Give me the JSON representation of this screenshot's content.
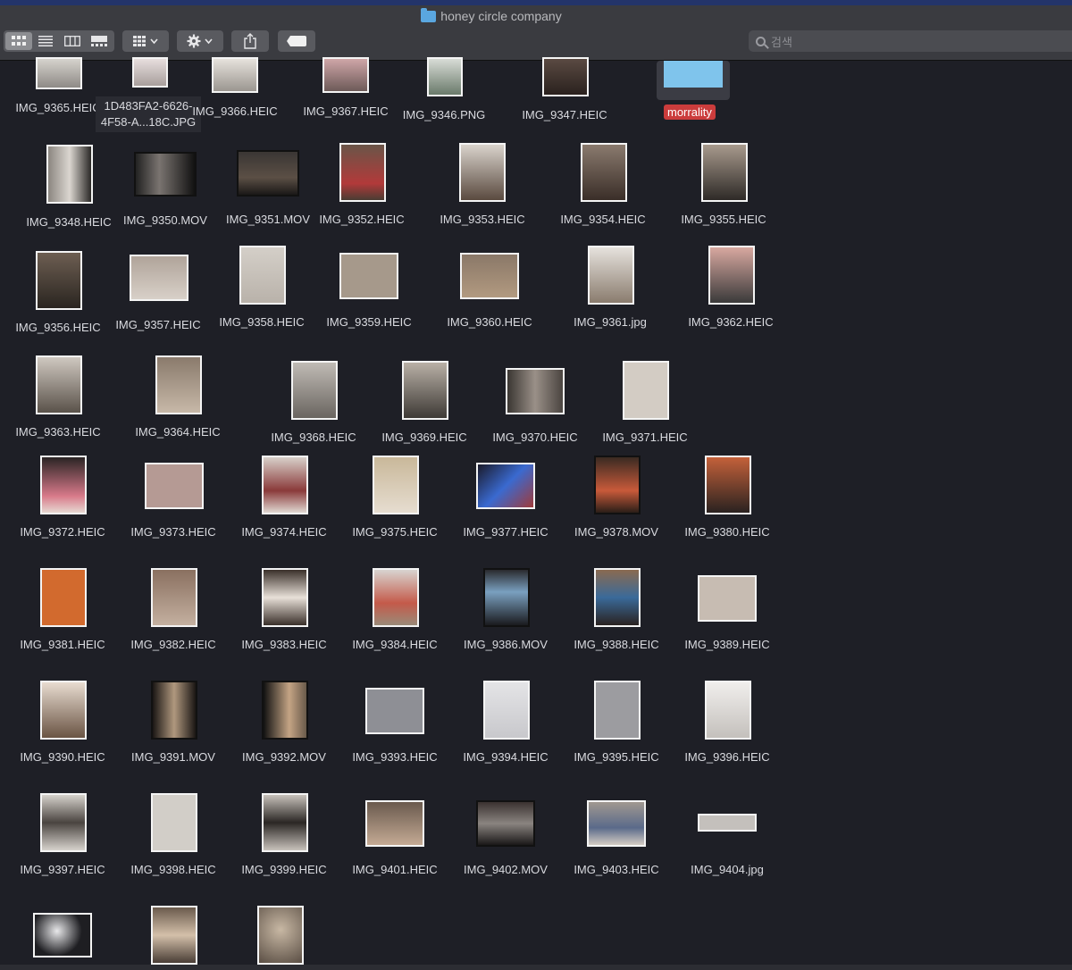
{
  "window": {
    "title": "honey circle company"
  },
  "toolbar": {
    "view_icons": [
      "icon-view-icon",
      "list-view-icon",
      "column-view-icon",
      "gallery-view-icon"
    ],
    "group_label": "group-icon",
    "action_label": "gear-icon",
    "share_label": "share-icon",
    "tag_label": "tag-icon"
  },
  "search": {
    "placeholder": "검색"
  },
  "tag": {
    "label": "morrality",
    "color": "#cb3c3c"
  },
  "files": {
    "row0": [
      "IMG_9365.HEIC",
      "1D483FA2-6626-4F58-A...18C.JPG",
      "IMG_9366.HEIC",
      "IMG_9367.HEIC",
      "IMG_9346.PNG",
      "IMG_9347.HEIC"
    ],
    "row1": [
      "IMG_9348.HEIC",
      "IMG_9350.MOV",
      "IMG_9351.MOV",
      "IMG_9352.HEIC",
      "IMG_9353.HEIC",
      "IMG_9354.HEIC",
      "IMG_9355.HEIC"
    ],
    "row2": [
      "IMG_9356.HEIC",
      "IMG_9357.HEIC",
      "IMG_9358.HEIC",
      "IMG_9359.HEIC",
      "IMG_9360.HEIC",
      "IMG_9361.jpg",
      "IMG_9362.HEIC"
    ],
    "row3": [
      "IMG_9363.HEIC",
      "IMG_9364.HEIC",
      "IMG_9368.HEIC",
      "IMG_9369.HEIC",
      "IMG_9370.HEIC",
      "IMG_9371.HEIC"
    ],
    "row4": [
      "IMG_9372.HEIC",
      "IMG_9373.HEIC",
      "IMG_9374.HEIC",
      "IMG_9375.HEIC",
      "IMG_9377.HEIC",
      "IMG_9378.MOV",
      "IMG_9380.HEIC"
    ],
    "row5": [
      "IMG_9381.HEIC",
      "IMG_9382.HEIC",
      "IMG_9383.HEIC",
      "IMG_9384.HEIC",
      "IMG_9386.MOV",
      "IMG_9388.HEIC",
      "IMG_9389.HEIC"
    ],
    "row6": [
      "IMG_9390.HEIC",
      "IMG_9391.MOV",
      "IMG_9392.MOV",
      "IMG_9393.HEIC",
      "IMG_9394.HEIC",
      "IMG_9395.HEIC",
      "IMG_9396.HEIC"
    ],
    "row7": [
      "IMG_9397.HEIC",
      "IMG_9398.HEIC",
      "IMG_9399.HEIC",
      "IMG_9401.HEIC",
      "IMG_9402.MOV",
      "IMG_9403.HEIC",
      "IMG_9404.jpg"
    ]
  }
}
